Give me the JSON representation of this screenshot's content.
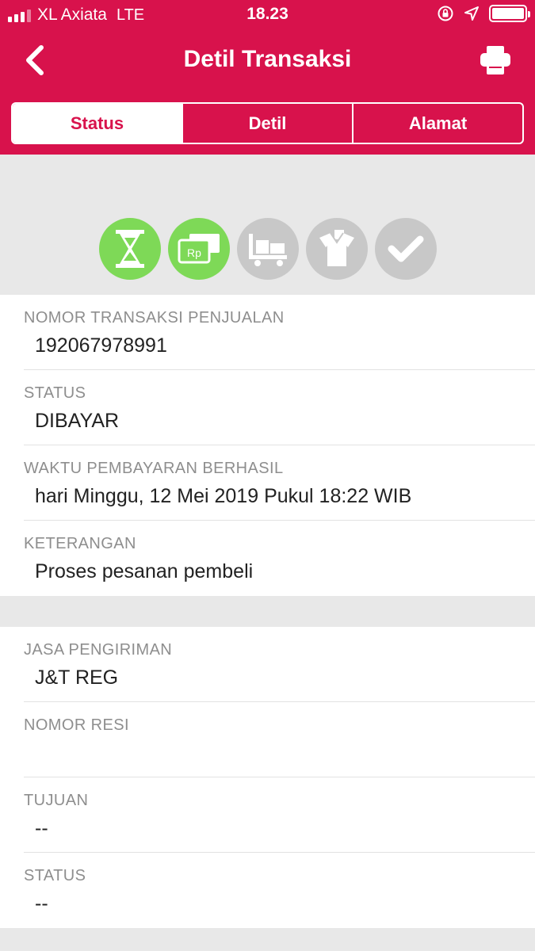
{
  "status_bar": {
    "carrier": "XL Axiata",
    "network": "LTE",
    "time": "18.23",
    "icons": [
      "signal-icon",
      "orientation-lock-icon",
      "location-arrow-icon",
      "battery-icon"
    ]
  },
  "header": {
    "title": "Detil Transaksi",
    "back_icon": "chevron-left-icon",
    "print_icon": "printer-icon"
  },
  "tabs": [
    {
      "label": "Status",
      "active": true
    },
    {
      "label": "Detil",
      "active": false
    },
    {
      "label": "Alamat",
      "active": false
    }
  ],
  "progress_steps": [
    {
      "icon": "hourglass-icon",
      "completed": true
    },
    {
      "icon": "payment-icon",
      "completed": true,
      "text": "Rp"
    },
    {
      "icon": "cart-icon",
      "completed": false
    },
    {
      "icon": "package-icon",
      "completed": false
    },
    {
      "icon": "checkmark-icon",
      "completed": false
    }
  ],
  "transaction": {
    "rows": [
      {
        "label": "NOMOR TRANSAKSI PENJUALAN",
        "value": "192067978991"
      },
      {
        "label": "STATUS",
        "value": "DIBAYAR"
      },
      {
        "label": "WAKTU PEMBAYARAN BERHASIL",
        "value": "hari Minggu, 12 Mei 2019 Pukul 18:22 WIB"
      },
      {
        "label": "KETERANGAN",
        "value": "Proses pesanan pembeli"
      }
    ]
  },
  "shipping": {
    "rows": [
      {
        "label": "JASA PENGIRIMAN",
        "value": "J&T REG"
      },
      {
        "label": "NOMOR RESI",
        "value": ""
      },
      {
        "label": "TUJUAN",
        "value": "--"
      },
      {
        "label": "STATUS",
        "value": "--"
      }
    ]
  },
  "colors": {
    "brand": "#d8124c",
    "step_done": "#7ed957",
    "step_todo": "#c8c8c8"
  }
}
